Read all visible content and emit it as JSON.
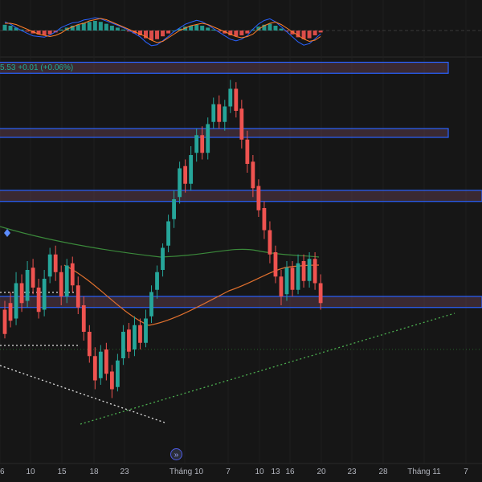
{
  "status_bar": {
    "text": "5.53  +0.01 (+0.06%)"
  },
  "scroll_button": {
    "glyph": "»"
  },
  "colors": {
    "background": "#161616",
    "up_candle": "#26a69a",
    "down_candle": "#ef5350",
    "zone_border": "#2962ff",
    "zone_fill": "#5a3a4a",
    "ma_orange": "#e0702e",
    "ma_green": "#3b8a3b",
    "macd_blue": "#2962ff",
    "signal_orange": "#ff7f2a",
    "trendline_green": "#4caf50",
    "dotted_white": "#e0e0e0",
    "marker_blue": "#5b8cff"
  },
  "chart_data": {
    "type": "candlestick",
    "title": "",
    "xlabel": "",
    "ylabel": "",
    "x_ticks": [
      "6",
      "10",
      "15",
      "18",
      "23",
      "Tháng 10",
      "7",
      "10",
      "13",
      "16",
      "20",
      "23",
      "28",
      "Tháng 11",
      "7"
    ],
    "grid": true,
    "legend": "none",
    "candles": [
      [
        38,
        27,
        25,
        42
      ],
      [
        41,
        33,
        30,
        46
      ],
      [
        34,
        50,
        31,
        55
      ],
      [
        50,
        41,
        37,
        54
      ],
      [
        42,
        56,
        39,
        60
      ],
      [
        57,
        48,
        45,
        61
      ],
      [
        48,
        37,
        34,
        52
      ],
      [
        38,
        52,
        35,
        56
      ],
      [
        53,
        63,
        50,
        66
      ],
      [
        63,
        55,
        51,
        67
      ],
      [
        55,
        44,
        40,
        58
      ],
      [
        44,
        58,
        41,
        61
      ],
      [
        59,
        49,
        46,
        62
      ],
      [
        49,
        39,
        36,
        53
      ],
      [
        40,
        28,
        24,
        44
      ],
      [
        28,
        17,
        14,
        31
      ],
      [
        17,
        6,
        2,
        21
      ],
      [
        7,
        19,
        4,
        22
      ],
      [
        20,
        9,
        6,
        23
      ],
      [
        10,
        2,
        -2,
        13
      ],
      [
        3,
        15,
        1,
        18
      ],
      [
        16,
        28,
        13,
        31
      ],
      [
        29,
        19,
        16,
        32
      ],
      [
        20,
        31,
        17,
        35
      ],
      [
        31,
        23,
        20,
        34
      ],
      [
        23,
        34,
        21,
        38
      ],
      [
        35,
        46,
        32,
        49
      ],
      [
        47,
        55,
        43,
        58
      ],
      [
        56,
        66,
        53,
        68
      ],
      [
        67,
        78,
        64,
        81
      ],
      [
        79,
        88,
        75,
        92
      ],
      [
        89,
        102,
        86,
        105
      ],
      [
        103,
        95,
        91,
        106
      ],
      [
        95,
        108,
        92,
        112
      ],
      [
        109,
        117,
        105,
        120
      ],
      [
        117,
        109,
        106,
        121
      ],
      [
        109,
        122,
        106,
        125
      ],
      [
        123,
        131,
        120,
        134
      ],
      [
        131,
        123,
        120,
        135
      ],
      [
        123,
        130,
        119,
        133
      ],
      [
        130,
        138,
        127,
        142
      ],
      [
        138,
        128,
        125,
        141
      ],
      [
        129,
        115,
        111,
        133
      ],
      [
        115,
        104,
        100,
        119
      ],
      [
        105,
        93,
        89,
        108
      ],
      [
        94,
        83,
        80,
        97
      ],
      [
        84,
        74,
        70,
        87
      ],
      [
        74,
        63,
        59,
        78
      ],
      [
        64,
        53,
        50,
        67
      ],
      [
        53,
        44,
        40,
        56
      ],
      [
        45,
        57,
        42,
        60
      ],
      [
        57,
        47,
        44,
        60
      ],
      [
        47,
        59,
        45,
        63
      ],
      [
        60,
        51,
        48,
        63
      ],
      [
        51,
        61,
        48,
        64
      ],
      [
        61,
        50,
        47,
        64
      ],
      [
        50,
        41,
        38,
        54
      ]
    ],
    "zones": [
      {
        "top": 150,
        "bottom": 145
      },
      {
        "top": 120,
        "bottom": 116
      },
      {
        "top": 92,
        "bottom": 87
      },
      {
        "top": 44,
        "bottom": 39
      }
    ],
    "macd_histogram": [
      0.6,
      0.5,
      0.3,
      0.1,
      -0.1,
      -0.3,
      -0.4,
      -0.5,
      -0.4,
      -0.2,
      0.1,
      0.3,
      0.5,
      0.6,
      0.8,
      0.9,
      1,
      0.9,
      0.7,
      0.5,
      0.3,
      0.1,
      -0.1,
      -0.3,
      -0.5,
      -0.8,
      -1,
      -0.9,
      -0.6,
      -0.3,
      0,
      0.2,
      0.4,
      0.5,
      0.6,
      0.5,
      0.3,
      0.1,
      -0.1,
      -0.3,
      -0.5,
      -0.6,
      -0.5,
      -0.3,
      0.1,
      0.4,
      0.6,
      0.7,
      0.5,
      0.2,
      -0.1,
      -0.4,
      -0.7,
      -0.9,
      -0.8,
      -0.5,
      -0.2
    ]
  }
}
